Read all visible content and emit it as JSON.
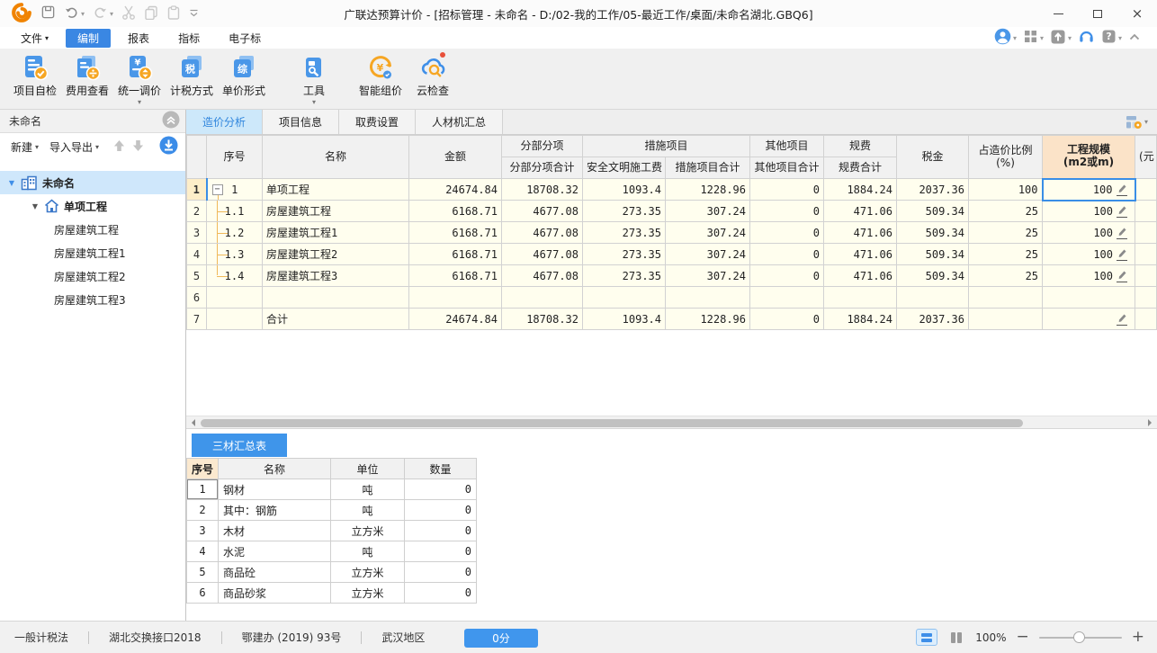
{
  "window": {
    "title": "广联达预算计价 - [招标管理 - 未命名 - D:/02-我的工作/05-最近工作/桌面/未命名湖北.GBQ6]"
  },
  "titlebar": {
    "icons": [
      "glodon-logo",
      "save",
      "undo",
      "redo",
      "cut",
      "copy",
      "paste",
      "more"
    ]
  },
  "menu": {
    "items": [
      {
        "label": "文件",
        "dropdown": true,
        "active": false
      },
      {
        "label": "编制",
        "dropdown": false,
        "active": true
      },
      {
        "label": "报表",
        "dropdown": false,
        "active": false
      },
      {
        "label": "指标",
        "dropdown": false,
        "active": false
      },
      {
        "label": "电子标",
        "dropdown": false,
        "active": false
      }
    ],
    "right_icons": [
      {
        "icon": "user-avatar",
        "caret": true
      },
      {
        "icon": "apps-grid",
        "caret": true
      },
      {
        "icon": "upload",
        "caret": true
      },
      {
        "icon": "headset",
        "caret": false
      },
      {
        "icon": "help",
        "caret": true
      },
      {
        "icon": "collapse-ribbon",
        "caret": false
      }
    ]
  },
  "ribbon": {
    "buttons": [
      {
        "label": "项目自检",
        "icon": "self-check",
        "dropdown": false,
        "badge": false
      },
      {
        "label": "费用查看",
        "icon": "fee-view",
        "dropdown": false,
        "badge": false
      },
      {
        "label": "统一调价",
        "icon": "adjust-price",
        "dropdown": true,
        "badge": false
      },
      {
        "label": "计税方式",
        "icon": "tax-method",
        "dropdown": false,
        "badge": false
      },
      {
        "label": "单价形式",
        "icon": "unit-price",
        "dropdown": false,
        "badge": false
      },
      {
        "label": "工具",
        "icon": "tools",
        "dropdown": true,
        "badge": false
      },
      {
        "label": "智能组价",
        "icon": "smart-price",
        "dropdown": false,
        "badge": false
      },
      {
        "label": "云检查",
        "icon": "cloud-check",
        "dropdown": false,
        "badge": true
      }
    ]
  },
  "sidebar": {
    "title": "未命名",
    "new_label": "新建",
    "import_label": "导入导出",
    "tree": [
      {
        "label": "未命名",
        "level": 0,
        "selected": true,
        "icon": "building",
        "arrow": true
      },
      {
        "label": "单项工程",
        "level": 1,
        "selected": false,
        "icon": "home",
        "arrow": true
      },
      {
        "label": "房屋建筑工程",
        "level": 2,
        "selected": false,
        "icon": "",
        "arrow": false
      },
      {
        "label": "房屋建筑工程1",
        "level": 2,
        "selected": false,
        "icon": "",
        "arrow": false
      },
      {
        "label": "房屋建筑工程2",
        "level": 2,
        "selected": false,
        "icon": "",
        "arrow": false
      },
      {
        "label": "房屋建筑工程3",
        "level": 2,
        "selected": false,
        "icon": "",
        "arrow": false
      }
    ]
  },
  "tabs": {
    "items": [
      {
        "label": "造价分析",
        "active": true
      },
      {
        "label": "项目信息",
        "active": false
      },
      {
        "label": "取费设置",
        "active": false
      },
      {
        "label": "人材机汇总",
        "active": false
      }
    ]
  },
  "cost_table": {
    "header": {
      "sn": "序号",
      "name": "名称",
      "amount": "金额",
      "fbfx_group": "分部分项",
      "fbfx_total": "分部分项合计",
      "cs_group": "措施项目",
      "safe_fee": "安全文明施工费",
      "cs_total": "措施项目合计",
      "qt_group": "其他项目",
      "qt_total": "其他项目合计",
      "gf_group": "规费",
      "gf_total": "规费合计",
      "tax": "税金",
      "ratio_line1": "占造价比例",
      "ratio_line2": "(%)",
      "scale_line1": "工程规模",
      "scale_line2": "(m2或m)",
      "partial": "(元"
    },
    "rows": [
      {
        "num": "1",
        "sn": "1",
        "expand": true,
        "connector": "start",
        "name": "单项工程",
        "cells": [
          "24674.84",
          "18708.32",
          "1093.4",
          "1228.96",
          "0",
          "1884.24",
          "2037.36",
          "100"
        ],
        "scale": "100",
        "pencil": true,
        "selected": true
      },
      {
        "num": "2",
        "sn": "1.1",
        "expand": false,
        "connector": "mid",
        "name": "房屋建筑工程",
        "cells": [
          "6168.71",
          "4677.08",
          "273.35",
          "307.24",
          "0",
          "471.06",
          "509.34",
          "25"
        ],
        "scale": "100",
        "pencil": true,
        "selected": false
      },
      {
        "num": "3",
        "sn": "1.2",
        "expand": false,
        "connector": "mid",
        "name": "房屋建筑工程1",
        "cells": [
          "6168.71",
          "4677.08",
          "273.35",
          "307.24",
          "0",
          "471.06",
          "509.34",
          "25"
        ],
        "scale": "100",
        "pencil": true,
        "selected": false
      },
      {
        "num": "4",
        "sn": "1.3",
        "expand": false,
        "connector": "mid",
        "name": "房屋建筑工程2",
        "cells": [
          "6168.71",
          "4677.08",
          "273.35",
          "307.24",
          "0",
          "471.06",
          "509.34",
          "25"
        ],
        "scale": "100",
        "pencil": true,
        "selected": false
      },
      {
        "num": "5",
        "sn": "1.4",
        "expand": false,
        "connector": "end",
        "name": "房屋建筑工程3",
        "cells": [
          "6168.71",
          "4677.08",
          "273.35",
          "307.24",
          "0",
          "471.06",
          "509.34",
          "25"
        ],
        "scale": "100",
        "pencil": true,
        "selected": false
      },
      {
        "num": "6",
        "sn": "",
        "expand": false,
        "connector": "",
        "name": "",
        "cells": [
          "",
          "",
          "",
          "",
          "",
          "",
          "",
          ""
        ],
        "scale": "",
        "pencil": false,
        "selected": false
      },
      {
        "num": "7",
        "sn": "",
        "expand": false,
        "connector": "",
        "name": "合计",
        "cells": [
          "24674.84",
          "18708.32",
          "1093.4",
          "1228.96",
          "0",
          "1884.24",
          "2037.36",
          ""
        ],
        "scale": "",
        "pencil": true,
        "selected": false
      }
    ]
  },
  "materials_panel": {
    "tab": "三材汇总表",
    "columns": [
      "序号",
      "名称",
      "单位",
      "数量"
    ],
    "rows": [
      [
        "1",
        "钢材",
        "吨",
        "0"
      ],
      [
        "2",
        "其中：钢筋",
        "吨",
        "0"
      ],
      [
        "3",
        "木材",
        "立方米",
        "0"
      ],
      [
        "4",
        "水泥",
        "吨",
        "0"
      ],
      [
        "5",
        "商品砼",
        "立方米",
        "0"
      ],
      [
        "6",
        "商品砂浆",
        "立方米",
        "0"
      ]
    ]
  },
  "statusbar": {
    "items": [
      "一般计税法",
      "湖北交换接口2018",
      "鄂建办 (2019) 93号",
      "武汉地区"
    ],
    "score": "0分",
    "zoom_level": "100%"
  },
  "colors": {
    "accent_blue": "#3a8ee6",
    "active_tab_bg": "#cde8fa",
    "cell_bg": "#fffeee",
    "scale_header_bg": "#fbe3c8",
    "selected_row_num_bg": "#fdeec9",
    "button_blue": "#4096ed",
    "icon_orange": "#f6a623",
    "logo_orange": "#f08300"
  }
}
